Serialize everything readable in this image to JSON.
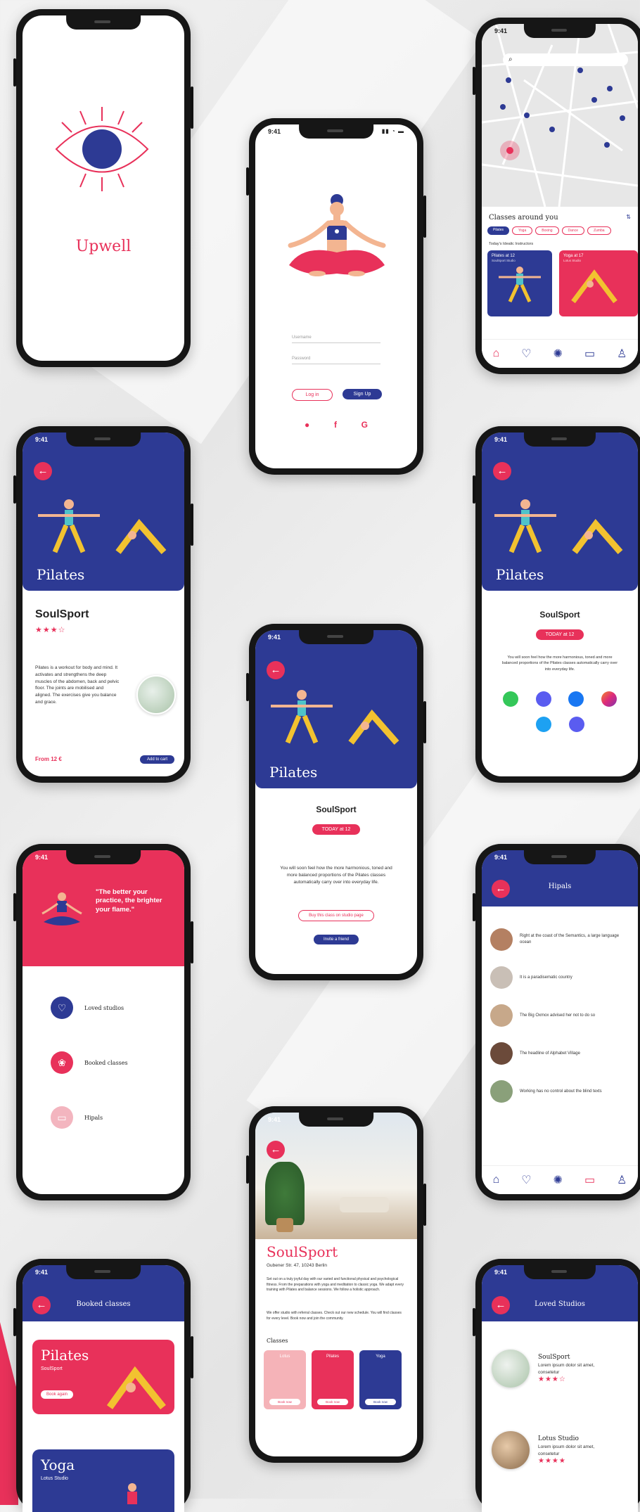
{
  "status_time": "9:41",
  "splash": {
    "app_name": "Upwell"
  },
  "login": {
    "username_placeholder": "Username",
    "password_placeholder": "Password",
    "login_label": "Log in",
    "signup_label": "Sign Up",
    "social_icons": [
      "apple-icon",
      "facebook-icon",
      "google-icon"
    ]
  },
  "map": {
    "search_icon": "search-icon",
    "section_title": "Classes around you",
    "filters": [
      "Pilates",
      "Yoga",
      "Boxing",
      "Dance",
      "Zumba"
    ],
    "subheading": "Today's Idealic Instructors",
    "cards": [
      {
        "title": "Pilates at 12",
        "sub": "SoulSport Studio"
      },
      {
        "title": "Yoga at 17",
        "sub": "Lotus Studio"
      }
    ]
  },
  "detail": {
    "category": "Pilates",
    "studio": "SoulSport",
    "rating": "★★★☆",
    "description": "Pilates is a workout for body and mind. It activates and strengthens the deep muscles of the abdomen, back and pelvic floor. The joints are mobilised and aligned. The exercises give you balance and grace.",
    "price": "From 12 €",
    "add_to_cart": "Add to cart"
  },
  "booking": {
    "category": "Pilates",
    "studio": "SoulSport",
    "time_label": "TODAY at 12",
    "body": "You will soon feel how the more harmonious, toned and more balanced proportions of the Pilates classes automatically carry over into everyday life.",
    "outline_button": "Buy this class on studio page",
    "invite_button": "Invite a friend"
  },
  "share": {
    "category": "Pilates",
    "studio": "SoulSport",
    "time_label": "TODAY at 12",
    "body": "You will soon feel how the more harmonious, toned and more balanced proportions of the Pilates classes automatically carry over into everyday life."
  },
  "menu": {
    "quote": "\"The better your practice, the brighter your flame.\"",
    "items": [
      "Loved studios",
      "Booked classes",
      "Hipals"
    ]
  },
  "hipals": {
    "title": "Hipals",
    "messages": [
      "Right at the coast of the Semantics, a large language ocean",
      "It is a paradisematic country",
      "The Big Oxmox advised her not to do so",
      "The headline of Alphabet Village",
      "Working has no control about the blind texts"
    ]
  },
  "studio": {
    "name": "SoulSport",
    "address": "Gubener Str. 47, 10243 Berlin",
    "para1": "Set out on a truly joyful day with our varied and functional physical and psychological fitness. From the preparations with yoga and meditation to classic yoga. We adapt every training with Pilates and balance sessions. We follow a holistic approach.",
    "para2": "We offer studio with referral classes. Check out our new schedule. You will find classes for every level. Book now and join the community.",
    "classes_heading": "Classes",
    "classes": [
      {
        "name": "Lotus",
        "action": "Book now"
      },
      {
        "name": "Pilates",
        "action": "Book now"
      },
      {
        "name": "Yoga",
        "action": "Book now"
      }
    ]
  },
  "booked": {
    "title": "Booked classes",
    "items": [
      {
        "name": "Pilates",
        "studio": "SoulSport",
        "action": "Book again"
      },
      {
        "name": "Yoga",
        "studio": "Lotus Studio"
      }
    ]
  },
  "loved": {
    "title": "Loved Studios",
    "items": [
      {
        "name": "SoulSport",
        "desc": "Lorem ipsum dolor sit amet, consetetur",
        "rating": "★★★☆"
      },
      {
        "name": "Lotus Studio",
        "desc": "Lorem ipsum dolor sit amet, consetetur",
        "rating": "★★★★"
      }
    ]
  },
  "colors": {
    "navy": "#2d3a94",
    "pink": "#e8315a",
    "yellow": "#f2c230"
  }
}
